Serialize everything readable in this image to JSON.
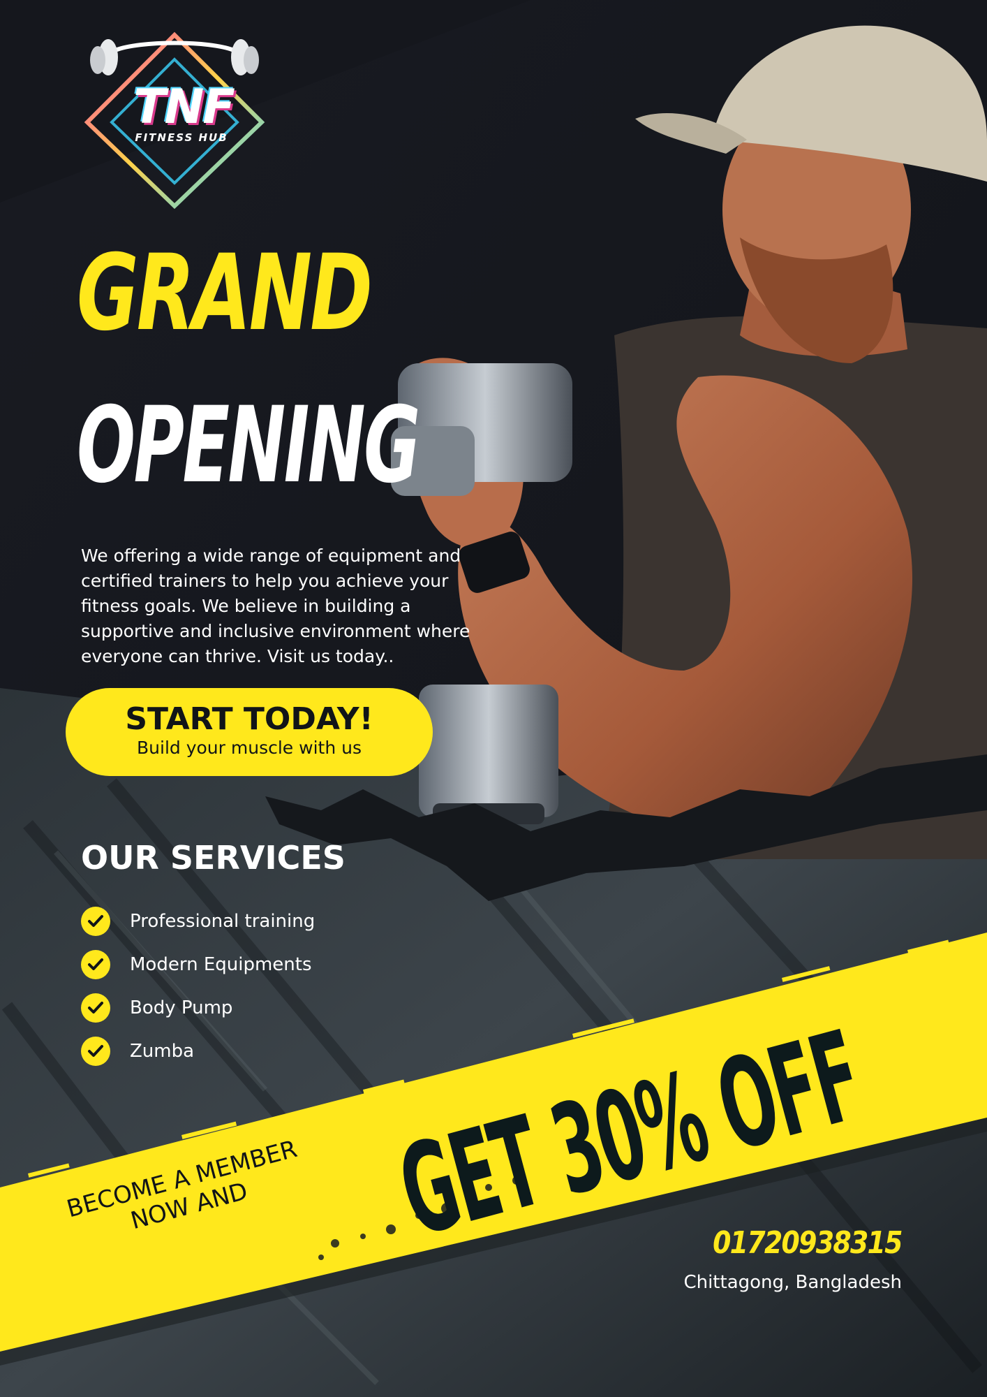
{
  "brand": {
    "logo_text": "TNF",
    "logo_subtext": "FITNESS HUB"
  },
  "headline": {
    "line1": "GRAND",
    "line2": "OPENING"
  },
  "intro": "We offering a wide range of equipment and certified trainers to help you achieve your fitness goals. We believe in building a supportive and inclusive environment where everyone can thrive. Visit us today..",
  "cta": {
    "title": "START TODAY!",
    "subtitle": "Build your muscle with us"
  },
  "services": {
    "title": "OUR SERVICES",
    "items": [
      {
        "label": "Professional training"
      },
      {
        "label": "Modern Equipments"
      },
      {
        "label": "Body Pump"
      },
      {
        "label": "Zumba"
      }
    ]
  },
  "promo": {
    "lead": "BECOME A MEMBER NOW AND",
    "offer": "GET 30% OFF"
  },
  "contact": {
    "phone": "01720938315",
    "location": "Chittagong, Bangladesh"
  },
  "icons": {
    "check": "check-icon",
    "barbell": "barbell-icon",
    "logo": "tnf-logo-icon"
  },
  "colors": {
    "accent_yellow": "#ffe81c",
    "background_dark": "#13151b",
    "text_white": "#ffffff",
    "text_dark": "#111418"
  }
}
